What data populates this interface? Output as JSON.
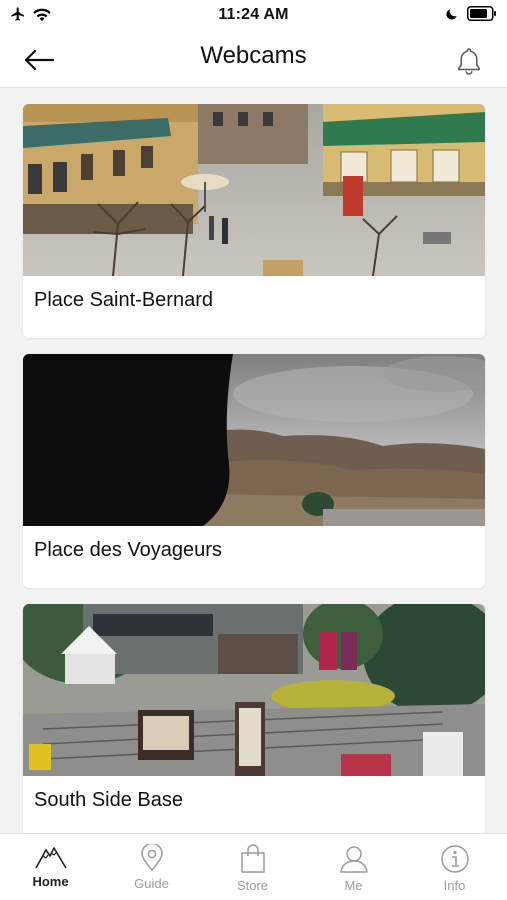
{
  "status_bar": {
    "time": "11:24 AM"
  },
  "header": {
    "title": "Webcams"
  },
  "webcams": [
    {
      "name": "Place Saint-Bernard"
    },
    {
      "name": "Place des Voyageurs"
    },
    {
      "name": "South Side Base"
    }
  ],
  "tabs": [
    {
      "label": "Home",
      "active": true
    },
    {
      "label": "Guide",
      "active": false
    },
    {
      "label": "Store",
      "active": false
    },
    {
      "label": "Me",
      "active": false
    },
    {
      "label": "Info",
      "active": false
    }
  ],
  "colors": {
    "accent": "#222222",
    "inactive": "#9b9b9b",
    "background": "#f2f2f2"
  }
}
